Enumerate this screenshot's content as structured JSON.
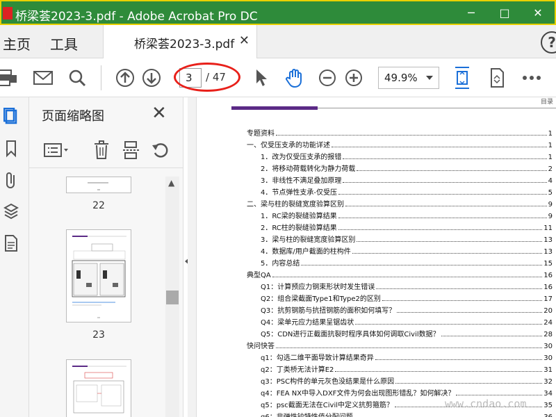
{
  "window": {
    "title": "桥梁荟2023-3.pdf - Adobe Acrobat Pro DC",
    "controls": [
      "─",
      "□",
      "✕"
    ]
  },
  "tabs": {
    "home": "主页",
    "tools": "工具",
    "doc": "桥梁荟2023-3.pdf",
    "help": "?"
  },
  "toolbar": {
    "page_current": "3",
    "page_total": "/ 47",
    "zoom": "49.9%"
  },
  "panel": {
    "title": "页面缩略图",
    "thumbs": [
      {
        "num": "22"
      },
      {
        "num": "23"
      }
    ]
  },
  "page": {
    "header_label": "目录"
  },
  "toc": [
    {
      "level": 1,
      "title": "专题资料",
      "page": "1"
    },
    {
      "level": 1,
      "title": "一、仅受压支承的功能详述",
      "page": "1"
    },
    {
      "level": 2,
      "title": "1．改为仅受压支承的报错",
      "page": "1"
    },
    {
      "level": 2,
      "title": "2．将移动荷载转化为静力荷载",
      "page": "2"
    },
    {
      "level": 2,
      "title": "3．非线性不满足叠加原理",
      "page": "4"
    },
    {
      "level": 2,
      "title": "4．节点弹性支承-仅受压",
      "page": "5"
    },
    {
      "level": 1,
      "title": "二、梁与柱的裂缝宽度验算区别",
      "page": "9"
    },
    {
      "level": 2,
      "title": "1．RC梁的裂缝验算结果",
      "page": "9"
    },
    {
      "level": 2,
      "title": "2．RC柱的裂缝验算结果",
      "page": "11"
    },
    {
      "level": 2,
      "title": "3．梁与柱的裂缝宽度验算区别",
      "page": "13"
    },
    {
      "level": 2,
      "title": "4．数据库/用户截面的柱构件",
      "page": "13"
    },
    {
      "level": 2,
      "title": "5．内容总结",
      "page": "15"
    },
    {
      "level": 1,
      "title": "典型QA",
      "page": "16"
    },
    {
      "level": 2,
      "title": "Q1：计算预应力钢束形状时发生错误",
      "page": "16"
    },
    {
      "level": 2,
      "title": "Q2：组合梁截面Type1和Type2的区别",
      "page": "17"
    },
    {
      "level": 2,
      "title": "Q3：抗剪钢筋与抗扭钢筋的面积如何填写？",
      "page": "20"
    },
    {
      "level": 2,
      "title": "Q4：梁单元应力结果呈锯齿状",
      "page": "24"
    },
    {
      "level": 2,
      "title": "Q5：CDN进行正截面抗裂时程序具体如何调取Civil数据？",
      "page": "28"
    },
    {
      "level": 1,
      "title": "快问快答",
      "page": "30"
    },
    {
      "level": 2,
      "title": "q1：勾选二维平面导致计算结果奇异",
      "page": "30"
    },
    {
      "level": 2,
      "title": "q2：丁类桥无法计算E2",
      "page": "31"
    },
    {
      "level": 2,
      "title": "q3：PSC构件的单元灰色没结果是什么原因",
      "page": "32"
    },
    {
      "level": 2,
      "title": "q4：FEA NX中导入DXF文件为何会出现图形错乱？如何解决？",
      "page": "34"
    },
    {
      "level": 2,
      "title": "q5：psc截面无法在Civil中定义抗剪箍筋？",
      "page": "35"
    },
    {
      "level": 2,
      "title": "q6：非弹性铰特性值分配问题",
      "page": "36"
    }
  ],
  "watermark": "www.cndao.com",
  "colors": {
    "titlebar": "#2e8b3a",
    "accent_blue": "#1a6fd8",
    "purple_bar": "#5b2a86",
    "highlight_oval": "#e8201a"
  }
}
